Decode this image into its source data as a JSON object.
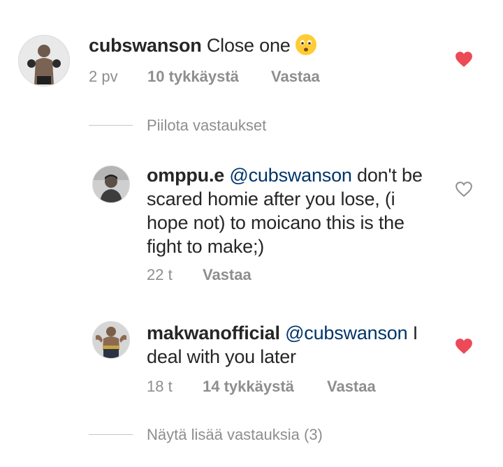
{
  "comments": [
    {
      "username": "cubswanson",
      "text": "Close one",
      "emoji_icon": "hushed-face-emoji",
      "time": "2 pv",
      "likes": "10 tykkäystä",
      "reply_label": "Vastaa",
      "liked": true
    }
  ],
  "hide_replies_label": "Piilota vastaukset",
  "replies": [
    {
      "username": "omppu.e",
      "mention": "@cubswanson",
      "text_line1": " don't be",
      "text_line2": "scared homie after you lose, (i",
      "text_line3": "hope not) to moicano this is the",
      "text_line4": "fight to make;)",
      "time": "22 t",
      "reply_label": "Vastaa",
      "liked": false
    },
    {
      "username": "makwanofficial",
      "mention": "@cubswanson",
      "text_line1": " I",
      "text_line2": "deal with you later",
      "time": "18 t",
      "likes": "14 tykkäystä",
      "reply_label": "Vastaa",
      "liked": true
    }
  ],
  "show_more_label": "Näytä lisää vastauksia (3)",
  "colors": {
    "heart_active": "#ed4956",
    "heart_outline": "#8e8e8e",
    "mention": "#003569",
    "meta": "#8e8e8e"
  }
}
